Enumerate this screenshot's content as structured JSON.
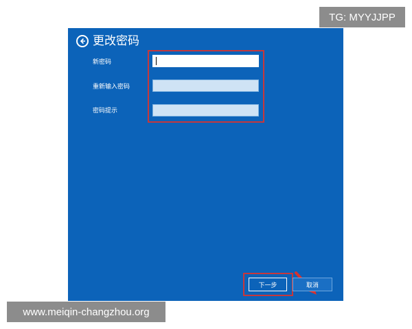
{
  "dialog": {
    "title": "更改密码",
    "fields": [
      {
        "label": "新密码",
        "value": "",
        "placeholder": ""
      },
      {
        "label": "重新输入密码",
        "value": "",
        "placeholder": ""
      },
      {
        "label": "密码提示",
        "value": "",
        "placeholder": ""
      }
    ],
    "next_label": "下一步",
    "cancel_label": "取消"
  },
  "watermarks": {
    "tg": "TG: MYYJJPP",
    "site": "www.meiqin-changzhou.org"
  },
  "colors": {
    "panel_bg": "#0c63b9",
    "highlight": "#c8373a",
    "watermark_bg": "#8c8c8c"
  },
  "icons": {
    "back": "back-arrow-circle-icon",
    "annotation": "red-arrow-icon"
  }
}
